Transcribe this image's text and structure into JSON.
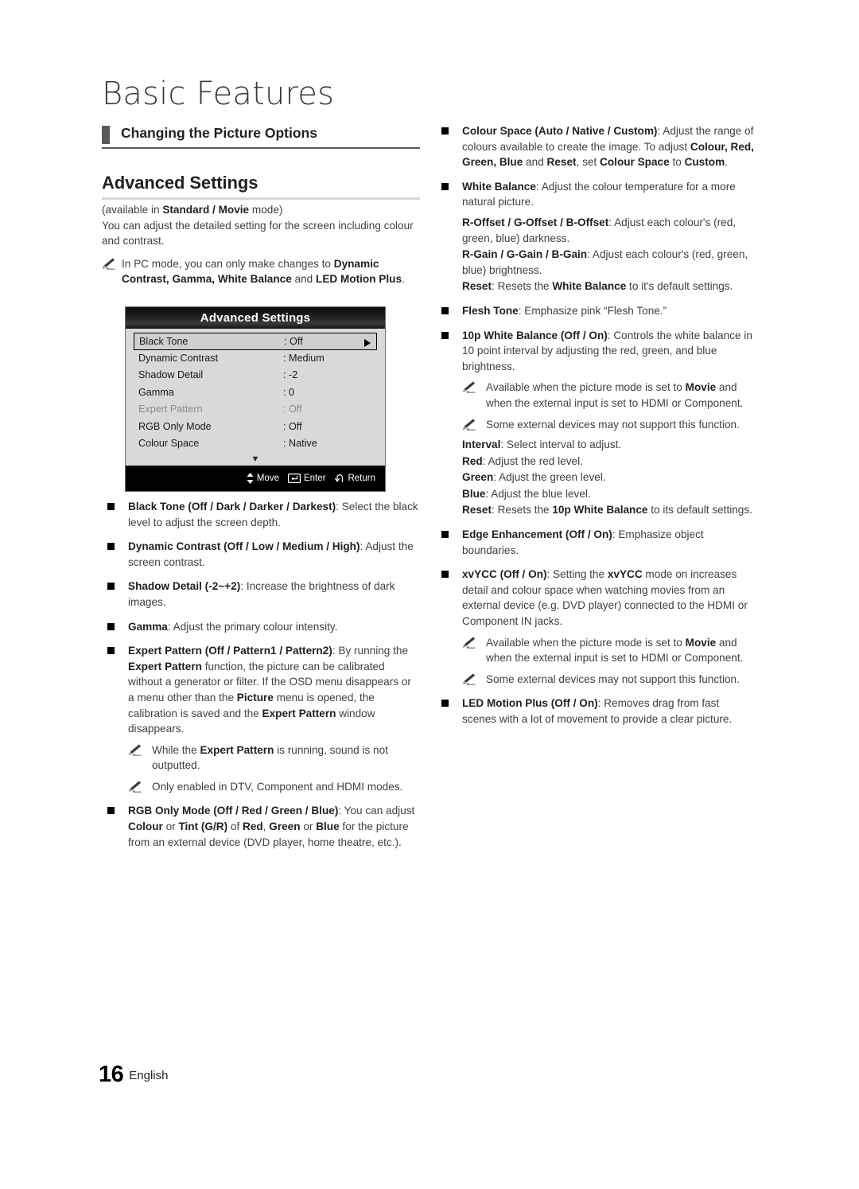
{
  "page": {
    "chapter_title": "Basic Features",
    "section_header": "Changing the Picture Options",
    "sub_heading": "Advanced Settings",
    "footer_page_number": "16",
    "footer_language": "English"
  },
  "intro": {
    "availability_prefix": "(available in ",
    "availability_bold": "Standard / Movie",
    "availability_suffix": " mode)",
    "description": "You can adjust the detailed setting for the screen including colour and contrast.",
    "pc_note_part1": "In PC mode, you can only make changes to ",
    "pc_note_bold1": "Dynamic Contrast, Gamma, White Balance",
    "pc_note_part2": " and ",
    "pc_note_bold2": "LED Motion Plus",
    "pc_note_part3": "."
  },
  "osd": {
    "title": "Advanced Settings",
    "rows": [
      {
        "label": "Black Tone",
        "value": ": Off",
        "selected": true,
        "dim": false
      },
      {
        "label": "Dynamic Contrast",
        "value": ": Medium",
        "selected": false,
        "dim": false
      },
      {
        "label": "Shadow Detail",
        "value": ": -2",
        "selected": false,
        "dim": false
      },
      {
        "label": "Gamma",
        "value": ": 0",
        "selected": false,
        "dim": false
      },
      {
        "label": "Expert Pattern",
        "value": ": Off",
        "selected": false,
        "dim": true
      },
      {
        "label": "RGB Only Mode",
        "value": ": Off",
        "selected": false,
        "dim": false
      },
      {
        "label": "Colour Space",
        "value": ": Native",
        "selected": false,
        "dim": false
      }
    ],
    "scroll_down_glyph": "▼",
    "footer": {
      "move_label": "Move",
      "enter_label": "Enter",
      "return_label": "Return"
    }
  },
  "left_column_bullets": {
    "black_tone": {
      "title": "Black Tone (Off / Dark / Darker / Darkest)",
      "body": ": Select the black level to adjust the screen depth."
    },
    "dynamic_contrast": {
      "title": "Dynamic Contrast (Off / Low / Medium / High)",
      "body": ": Adjust the screen contrast."
    },
    "shadow_detail": {
      "title": "Shadow Detail (-2~+2)",
      "body": ": Increase the brightness of dark images."
    },
    "gamma": {
      "title": "Gamma",
      "body": ": Adjust the primary colour intensity."
    },
    "expert_pattern": {
      "title": "Expert Pattern (Off / Pattern1 / Pattern2)",
      "b1": ": By running the ",
      "bold1": "Expert Pattern",
      "b2": " function, the picture can be calibrated without a generator or filter. If the OSD menu disappears or a menu other than the ",
      "bold2": "Picture",
      "b3": " menu is opened, the calibration is saved and the ",
      "bold3": "Expert Pattern",
      "b4": " window disappears.",
      "note1_a": "While the ",
      "note1_bold": "Expert Pattern",
      "note1_b": " is running, sound is not outputted.",
      "note2": "Only enabled in DTV, Component and HDMI modes."
    },
    "rgb_only_mode": {
      "title": "RGB Only Mode (Off / Red / Green / Blue)",
      "b1": ": You can adjust ",
      "bold1": "Colour",
      "b2": " or ",
      "bold2": "Tint (G/R)",
      "b3": " of ",
      "bold3": "Red",
      "b4": ", ",
      "bold4": "Green",
      "b5": " or ",
      "bold5": "Blue",
      "b6": " for the picture from an external device (DVD player, home theatre, etc.)."
    }
  },
  "right_column_bullets": {
    "colour_space": {
      "title": "Colour Space (Auto / Native / Custom)",
      "b1": ": Adjust the range of colours available to create the image. To adjust ",
      "bold1": "Colour, Red, Green, Blue",
      "b2": " and ",
      "bold2": "Reset",
      "b3": ", set ",
      "bold3": "Colour Space",
      "b4": " to ",
      "bold4": "Custom",
      "b5": "."
    },
    "white_balance": {
      "title": "White Balance",
      "body": ": Adjust the colour temperature for a more natural picture.",
      "offset_title": "R-Offset / G-Offset / B-Offset",
      "offset_body": ": Adjust each colour's (red, green, blue) darkness.",
      "gain_title": "R-Gain / G-Gain / B-Gain",
      "gain_body": ": Adjust each colour's (red, green, blue) brightness.",
      "reset_title": "Reset",
      "reset_b1": ": Resets the ",
      "reset_bold": "White Balance",
      "reset_b2": " to it's default settings."
    },
    "flesh_tone": {
      "title": "Flesh Tone",
      "body": ": Emphasize pink “Flesh Tone.”"
    },
    "white_balance_10p": {
      "title": "10p White Balance (Off / On)",
      "body": ": Controls the white balance in 10 point interval by adjusting the red, green, and blue brightness.",
      "note1_a": "Available when the picture mode is set to ",
      "note1_bold": "Movie",
      "note1_b": " and when the external input is set to HDMI or Component.",
      "note2": "Some external devices may not support this function.",
      "interval_title": "Interval",
      "interval_body": ": Select interval to adjust.",
      "red_title": "Red",
      "red_body": ": Adjust the red level.",
      "green_title": "Green",
      "green_body": ": Adjust the green level.",
      "blue_title": "Blue",
      "blue_body": ": Adjust the blue level.",
      "reset_title": "Reset",
      "reset_b1": ": Resets the ",
      "reset_bold": "10p White Balance",
      "reset_b2": " to its default settings."
    },
    "edge_enhancement": {
      "title": "Edge Enhancement (Off / On)",
      "body": ": Emphasize object boundaries."
    },
    "xvycc": {
      "title": "xvYCC (Off / On)",
      "b1": ": Setting the ",
      "bold1": "xvYCC",
      "b2": " mode on increases detail and colour space when watching movies from an external device (e.g. DVD player) connected to the HDMI or Component IN jacks.",
      "note1_a": "Available when the picture mode is set to ",
      "note1_bold": "Movie",
      "note1_b": " and when the external input is set to HDMI or Component.",
      "note2": "Some external devices may not support this function."
    },
    "led_motion_plus": {
      "title": "LED Motion Plus (Off / On)",
      "body": ": Removes drag from fast scenes with a lot of movement to provide a clear picture."
    }
  }
}
